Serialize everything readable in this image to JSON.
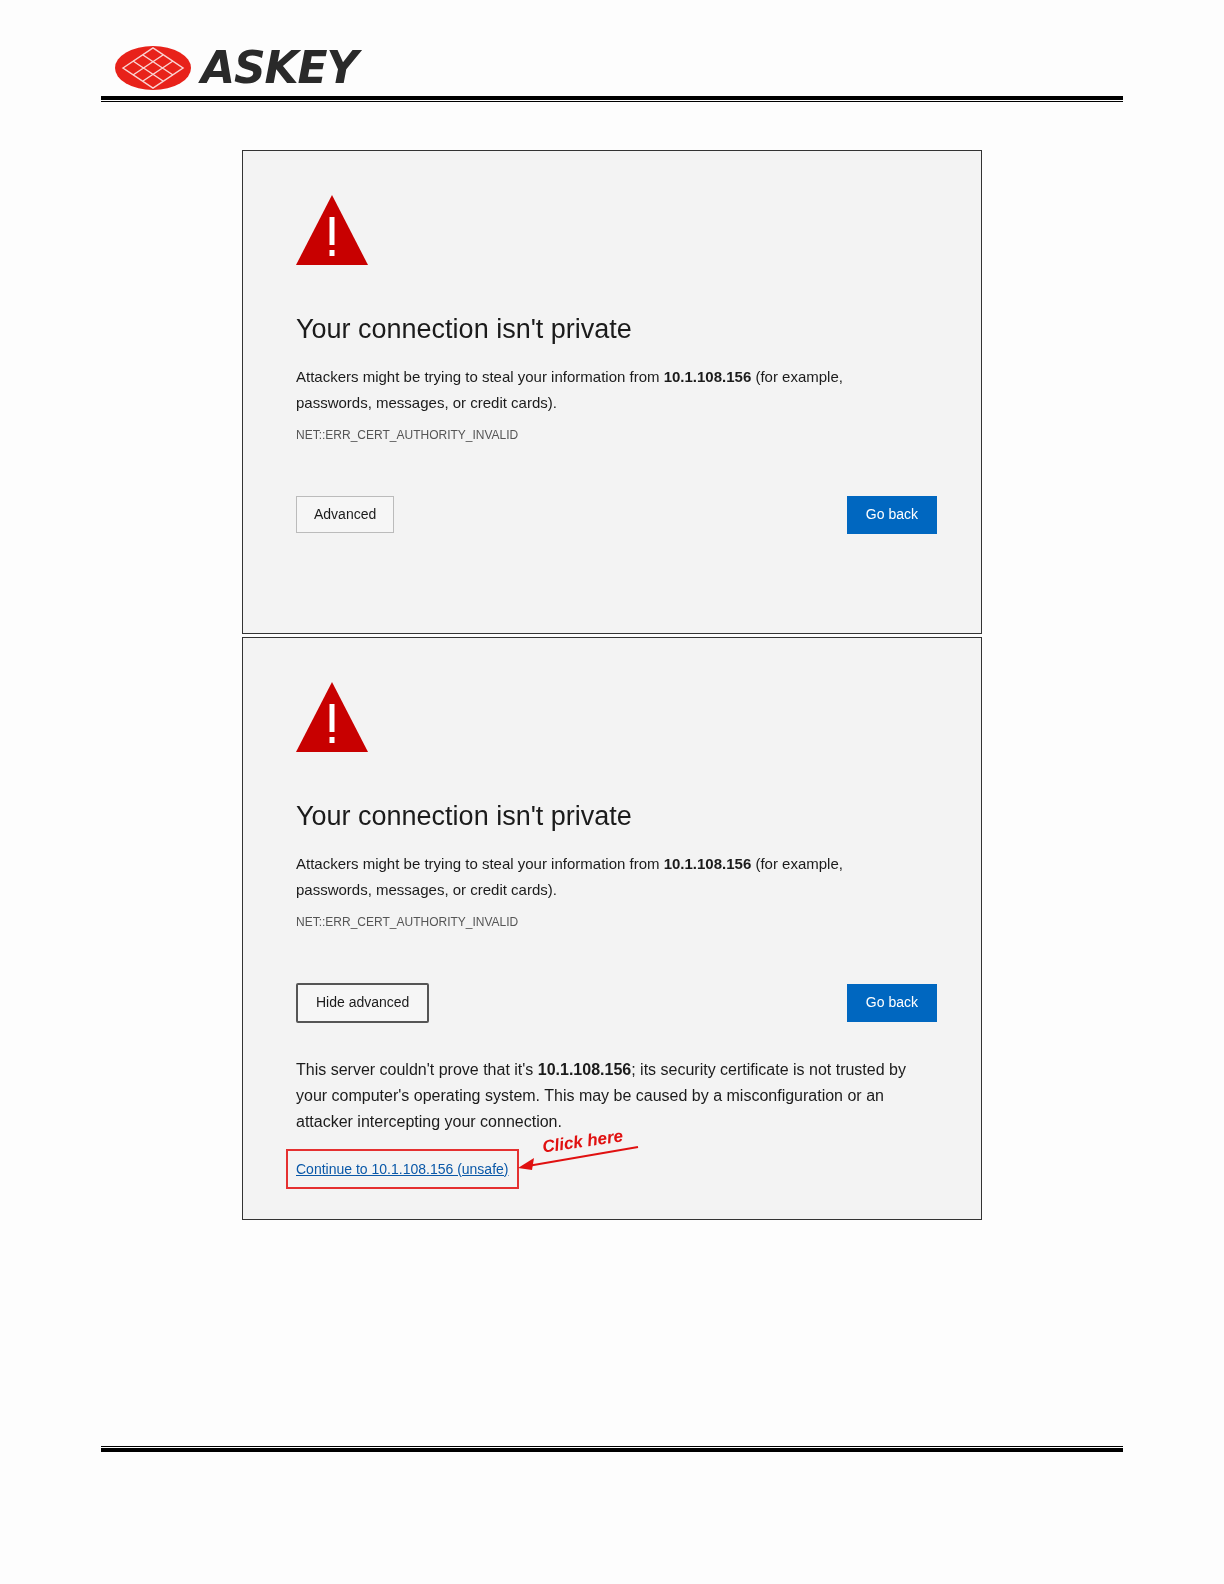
{
  "header": {
    "logo": "ASKEY"
  },
  "panels": [
    {
      "heading": "Your connection isn't private",
      "message": "Attackers might be trying to steal your information from **10.1.108.156** (for example, passwords, messages, or credit cards).",
      "error_code": "NET::ERR_CERT_AUTHORITY_INVALID",
      "advanced_button": {
        "label": "Advanced",
        "expanded": false
      },
      "primary_button": "Go back"
    },
    {
      "heading": "Your connection isn't private",
      "message": "Attackers might be trying to steal your information from **10.1.108.156** (for example, passwords, messages, or credit cards).",
      "error_code": "NET::ERR_CERT_AUTHORITY_INVALID",
      "advanced_button": {
        "label": "Hide advanced",
        "expanded": true
      },
      "primary_button": "Go back",
      "details": "This server couldn't prove that it's **10.1.108.156**; its security certificate is not trusted by your computer's operating system. This may be caused by a misconfiguration or an attacker intercepting your connection.",
      "proceed_link": "Continue to 10.1.108.156 (unsafe)",
      "annotation": "Click here"
    }
  ]
}
